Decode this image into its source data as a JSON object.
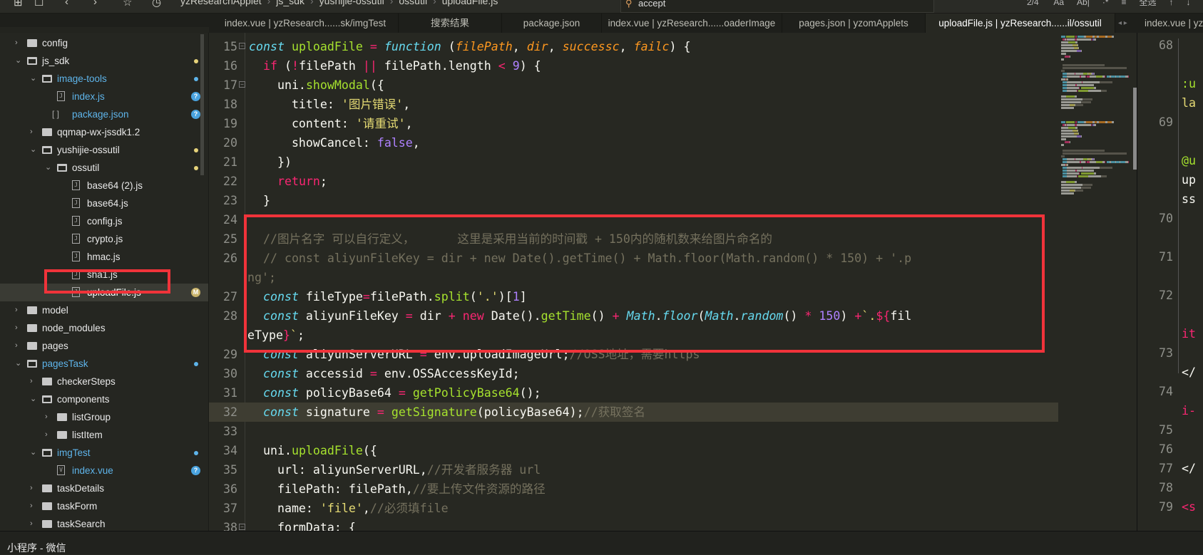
{
  "toolbar": {
    "icons": [
      "new-file-icon",
      "window-icon",
      "back-icon",
      "forward-icon",
      "bookmark-icon",
      "run-icon"
    ],
    "icon_glyphs": [
      "⊞",
      "☐",
      "‹",
      "›",
      "☆",
      "◷"
    ],
    "breadcrumb": [
      "yzResearchApplet",
      "js_sdk",
      "yushijie-ossutil",
      "ossutil",
      "uploadFile.js"
    ],
    "search_value": "accept",
    "search_count": "2/4",
    "search_tools": [
      "Aa",
      "Ab|",
      "·*",
      "≡",
      "全选",
      "↑",
      "↓"
    ]
  },
  "tabs": [
    {
      "label": "index.vue | yzResearch......sk/imgTest",
      "active": false
    },
    {
      "label": "搜索结果",
      "active": false
    },
    {
      "label": "package.json",
      "active": false
    },
    {
      "label": "index.vue | yzResearch......oaderImage",
      "active": false
    },
    {
      "label": "pages.json | yzomApplets",
      "active": false
    },
    {
      "label": "uploadFile.js | yzResearch......il/ossutil",
      "active": true
    }
  ],
  "right_tab": {
    "label": "index.vue | yzResearch"
  },
  "tab_arrows": "◂ ▸",
  "sidebar": {
    "items": [
      {
        "label": "config",
        "level": 0,
        "type": "folder",
        "open": false,
        "color": "#e8e8e8"
      },
      {
        "label": "js_sdk",
        "level": 0,
        "type": "folder",
        "open": true,
        "color": "#e8e8e8",
        "dot": "#e6d27a"
      },
      {
        "label": "image-tools",
        "level": 1,
        "type": "folder",
        "open": true,
        "color": "#5eb4ea",
        "dot": "#5eb4ea"
      },
      {
        "label": "index.js",
        "level": 2,
        "type": "js",
        "color": "#5eb4ea",
        "badge": "?",
        "badge_color": "#4aa3df"
      },
      {
        "label": "package.json",
        "level": 2,
        "type": "json",
        "color": "#5eb4ea",
        "badge": "?",
        "badge_color": "#4aa3df"
      },
      {
        "label": "qqmap-wx-jssdk1.2",
        "level": 1,
        "type": "folder",
        "open": false,
        "color": "#e8e8e8"
      },
      {
        "label": "yushijie-ossutil",
        "level": 1,
        "type": "folder",
        "open": true,
        "color": "#e8e8e8",
        "dot": "#e6d27a"
      },
      {
        "label": "ossutil",
        "level": 2,
        "type": "folder",
        "open": true,
        "color": "#e8e8e8",
        "dot": "#e6d27a"
      },
      {
        "label": "base64 (2).js",
        "level": 3,
        "type": "js",
        "color": "#e8e8e8"
      },
      {
        "label": "base64.js",
        "level": 3,
        "type": "js",
        "color": "#e8e8e8"
      },
      {
        "label": "config.js",
        "level": 3,
        "type": "js",
        "color": "#e8e8e8"
      },
      {
        "label": "crypto.js",
        "level": 3,
        "type": "js",
        "color": "#e8e8e8"
      },
      {
        "label": "hmac.js",
        "level": 3,
        "type": "js",
        "color": "#e8e8e8"
      },
      {
        "label": "sha1.js",
        "level": 3,
        "type": "js",
        "color": "#e8e8e8"
      },
      {
        "label": "uploadFile.js",
        "level": 3,
        "type": "js",
        "color": "#ffffff",
        "selected": true,
        "badge": "M",
        "badge_color": "#c9b36a"
      },
      {
        "label": "model",
        "level": 0,
        "type": "folder",
        "open": false,
        "color": "#e8e8e8"
      },
      {
        "label": "node_modules",
        "level": 0,
        "type": "folder",
        "open": false,
        "color": "#e8e8e8"
      },
      {
        "label": "pages",
        "level": 0,
        "type": "folder",
        "open": false,
        "color": "#e8e8e8"
      },
      {
        "label": "pagesTask",
        "level": 0,
        "type": "folder",
        "open": true,
        "color": "#5eb4ea",
        "dot": "#5eb4ea"
      },
      {
        "label": "checkerSteps",
        "level": 1,
        "type": "folder",
        "open": false,
        "color": "#e8e8e8"
      },
      {
        "label": "components",
        "level": 1,
        "type": "folder",
        "open": true,
        "color": "#e8e8e8"
      },
      {
        "label": "listGroup",
        "level": 2,
        "type": "folder",
        "open": false,
        "color": "#e8e8e8"
      },
      {
        "label": "listItem",
        "level": 2,
        "type": "folder",
        "open": false,
        "color": "#e8e8e8"
      },
      {
        "label": "imgTest",
        "level": 1,
        "type": "folder",
        "open": true,
        "color": "#5eb4ea",
        "dot": "#5eb4ea"
      },
      {
        "label": "index.vue",
        "level": 2,
        "type": "vue",
        "color": "#5eb4ea",
        "badge": "?",
        "badge_color": "#4aa3df"
      },
      {
        "label": "taskDetails",
        "level": 1,
        "type": "folder",
        "open": false,
        "color": "#e8e8e8"
      },
      {
        "label": "taskForm",
        "level": 1,
        "type": "folder",
        "open": false,
        "color": "#e8e8e8"
      },
      {
        "label": "taskSearch",
        "level": 1,
        "type": "folder",
        "open": false,
        "color": "#e8e8e8"
      }
    ]
  },
  "editor": {
    "highlight_color": "#f0333a",
    "lines": [
      {
        "n": "15",
        "fold": true,
        "t": [
          [
            "kw",
            "const"
          ],
          [
            "plain",
            " "
          ],
          [
            "fn",
            "uploadFile"
          ],
          [
            "plain",
            " "
          ],
          [
            "op",
            "="
          ],
          [
            "plain",
            " "
          ],
          [
            "kw",
            "function"
          ],
          [
            "plain",
            " ("
          ],
          [
            "param",
            "filePath"
          ],
          [
            "plain",
            ", "
          ],
          [
            "param",
            "dir"
          ],
          [
            "plain",
            ", "
          ],
          [
            "param",
            "successc"
          ],
          [
            "plain",
            ", "
          ],
          [
            "param",
            "failc"
          ],
          [
            "plain",
            ") {"
          ]
        ]
      },
      {
        "n": "16",
        "t": [
          [
            "plain",
            "  "
          ],
          [
            "op",
            "if"
          ],
          [
            "plain",
            " ("
          ],
          [
            "op",
            "!"
          ],
          [
            "plain",
            "filePath "
          ],
          [
            "op",
            "||"
          ],
          [
            "plain",
            " filePath.length "
          ],
          [
            "op",
            "<"
          ],
          [
            "plain",
            " "
          ],
          [
            "num",
            "9"
          ],
          [
            "plain",
            ") {"
          ]
        ]
      },
      {
        "n": "17",
        "fold": true,
        "t": [
          [
            "plain",
            "    uni."
          ],
          [
            "fn",
            "showModal"
          ],
          [
            "plain",
            "({"
          ]
        ]
      },
      {
        "n": "18",
        "t": [
          [
            "plain",
            "      title: "
          ],
          [
            "str",
            "'图片错误'"
          ],
          [
            "plain",
            ","
          ]
        ]
      },
      {
        "n": "19",
        "t": [
          [
            "plain",
            "      content: "
          ],
          [
            "str",
            "'请重试'"
          ],
          [
            "plain",
            ","
          ]
        ]
      },
      {
        "n": "20",
        "t": [
          [
            "plain",
            "      showCancel: "
          ],
          [
            "num",
            "false"
          ],
          [
            "plain",
            ","
          ]
        ]
      },
      {
        "n": "21",
        "t": [
          [
            "plain",
            "    })"
          ]
        ]
      },
      {
        "n": "22",
        "t": [
          [
            "plain",
            "    "
          ],
          [
            "op",
            "return"
          ],
          [
            "plain",
            ";"
          ]
        ]
      },
      {
        "n": "23",
        "t": [
          [
            "plain",
            "  }"
          ]
        ]
      },
      {
        "n": "24",
        "t": []
      },
      {
        "n": "25",
        "t": [
          [
            "plain",
            "  "
          ],
          [
            "cm",
            "//图片名字 可以自行定义，      这里是采用当前的时间戳 + 150内的随机数来给图片命名的"
          ]
        ]
      },
      {
        "n": "26",
        "t": [
          [
            "plain",
            "  "
          ],
          [
            "cm",
            "// const aliyunFileKey = dir + new Date().getTime() + Math.floor(Math.random() * 150) + '.p"
          ]
        ]
      },
      {
        "n": "",
        "wrap": true,
        "t": [
          [
            "cm",
            "ng';"
          ]
        ]
      },
      {
        "n": "27",
        "t": [
          [
            "plain",
            "  "
          ],
          [
            "kw",
            "const"
          ],
          [
            "plain",
            " fileType"
          ],
          [
            "op",
            "="
          ],
          [
            "plain",
            "filePath."
          ],
          [
            "fn",
            "split"
          ],
          [
            "plain",
            "("
          ],
          [
            "str",
            "'.'"
          ],
          [
            "plain",
            ")["
          ],
          [
            "num",
            "1"
          ],
          [
            "plain",
            "]"
          ]
        ]
      },
      {
        "n": "28",
        "t": [
          [
            "plain",
            "  "
          ],
          [
            "kw",
            "const"
          ],
          [
            "plain",
            " aliyunFileKey "
          ],
          [
            "op",
            "="
          ],
          [
            "plain",
            " dir "
          ],
          [
            "op",
            "+"
          ],
          [
            "plain",
            " "
          ],
          [
            "op",
            "new"
          ],
          [
            "plain",
            " Date()."
          ],
          [
            "fn",
            "getTime"
          ],
          [
            "plain",
            "() "
          ],
          [
            "op",
            "+"
          ],
          [
            "plain",
            " "
          ],
          [
            "kw",
            "Math"
          ],
          [
            "plain",
            "."
          ],
          [
            "kw",
            "floor"
          ],
          [
            "plain",
            "("
          ],
          [
            "kw",
            "Math"
          ],
          [
            "plain",
            "."
          ],
          [
            "kw",
            "random"
          ],
          [
            "plain",
            "() "
          ],
          [
            "op",
            "*"
          ],
          [
            "plain",
            " "
          ],
          [
            "num",
            "150"
          ],
          [
            "plain",
            ") "
          ],
          [
            "op",
            "+"
          ],
          [
            "str",
            "`."
          ],
          [
            "op",
            "${"
          ],
          [
            "plain",
            "fil"
          ]
        ]
      },
      {
        "n": "",
        "wrap": true,
        "t": [
          [
            "plain",
            "eType"
          ],
          [
            "op",
            "}"
          ],
          [
            "str",
            "`"
          ],
          [
            "plain",
            ";"
          ]
        ]
      },
      {
        "n": "29",
        "t": [
          [
            "plain",
            "  "
          ],
          [
            "kw",
            "const"
          ],
          [
            "plain",
            " aliyunServerURL "
          ],
          [
            "op",
            "="
          ],
          [
            "plain",
            " env.uploadImageUrl;"
          ],
          [
            "cm",
            "//OSS地址，需要https"
          ]
        ]
      },
      {
        "n": "30",
        "t": [
          [
            "plain",
            "  "
          ],
          [
            "kw",
            "const"
          ],
          [
            "plain",
            " accessid "
          ],
          [
            "op",
            "="
          ],
          [
            "plain",
            " env.OSSAccessKeyId;"
          ]
        ]
      },
      {
        "n": "31",
        "t": [
          [
            "plain",
            "  "
          ],
          [
            "kw",
            "const"
          ],
          [
            "plain",
            " policyBase64 "
          ],
          [
            "op",
            "="
          ],
          [
            "plain",
            " "
          ],
          [
            "fn",
            "getPolicyBase64"
          ],
          [
            "plain",
            "();"
          ]
        ]
      },
      {
        "n": "32",
        "current": true,
        "t": [
          [
            "plain",
            "  "
          ],
          [
            "kw",
            "const"
          ],
          [
            "plain",
            " signature "
          ],
          [
            "op",
            "="
          ],
          [
            "plain",
            " "
          ],
          [
            "fn",
            "getSignature"
          ],
          [
            "plain",
            "(policyBase64);"
          ],
          [
            "cm",
            "//获取签名"
          ]
        ]
      },
      {
        "n": "33",
        "t": []
      },
      {
        "n": "34",
        "t": [
          [
            "plain",
            "  uni."
          ],
          [
            "fn",
            "uploadFile"
          ],
          [
            "plain",
            "({"
          ]
        ]
      },
      {
        "n": "35",
        "t": [
          [
            "plain",
            "    url: aliyunServerURL,"
          ],
          [
            "cm",
            "//开发者服务器 url"
          ]
        ]
      },
      {
        "n": "36",
        "t": [
          [
            "plain",
            "    filePath: filePath,"
          ],
          [
            "cm",
            "//要上传文件资源的路径"
          ]
        ]
      },
      {
        "n": "37",
        "t": [
          [
            "plain",
            "    name: "
          ],
          [
            "str",
            "'file'"
          ],
          [
            "plain",
            ","
          ],
          [
            "cm",
            "//必须填file"
          ]
        ]
      },
      {
        "n": "38",
        "fold": true,
        "t": [
          [
            "plain",
            "    formData: {"
          ]
        ]
      }
    ]
  },
  "right_pane": {
    "line_numbers": [
      {
        "n": "68",
        "row": 0
      },
      {
        "n": "69",
        "row": 4
      },
      {
        "n": "70",
        "row": 9
      },
      {
        "n": "71",
        "row": 11
      },
      {
        "n": "72",
        "row": 13
      },
      {
        "n": "73",
        "row": 16
      },
      {
        "n": "74",
        "row": 18
      },
      {
        "n": "75",
        "row": 20
      },
      {
        "n": "76",
        "row": 21
      },
      {
        "n": "77",
        "row": 22
      },
      {
        "n": "78",
        "row": 23
      },
      {
        "n": "79",
        "row": 24
      }
    ],
    "fragments": [
      {
        "text": ":u",
        "row": 2,
        "color": "#a6e22e"
      },
      {
        "text": "la",
        "row": 3,
        "color": "#e6db74"
      },
      {
        "text": "@u",
        "row": 6,
        "color": "#a6e22e"
      },
      {
        "text": "up",
        "row": 7,
        "color": "#f8f8f2"
      },
      {
        "text": "ss",
        "row": 8,
        "color": "#f8f8f2"
      },
      {
        "text": "it",
        "row": 15,
        "color": "#f92672"
      },
      {
        "text": "</",
        "row": 17,
        "color": "#f8f8f2"
      },
      {
        "text": "i-",
        "row": 19,
        "color": "#f92672"
      },
      {
        "text": "</",
        "row": 22,
        "color": "#f8f8f2"
      },
      {
        "text": "<s",
        "row": 24,
        "color": "#f92672"
      }
    ]
  },
  "scroll": {
    "editor_position": 0.17,
    "sidebar_position": 0.0
  },
  "statusbar": {
    "title": "小程序 - 微信"
  }
}
